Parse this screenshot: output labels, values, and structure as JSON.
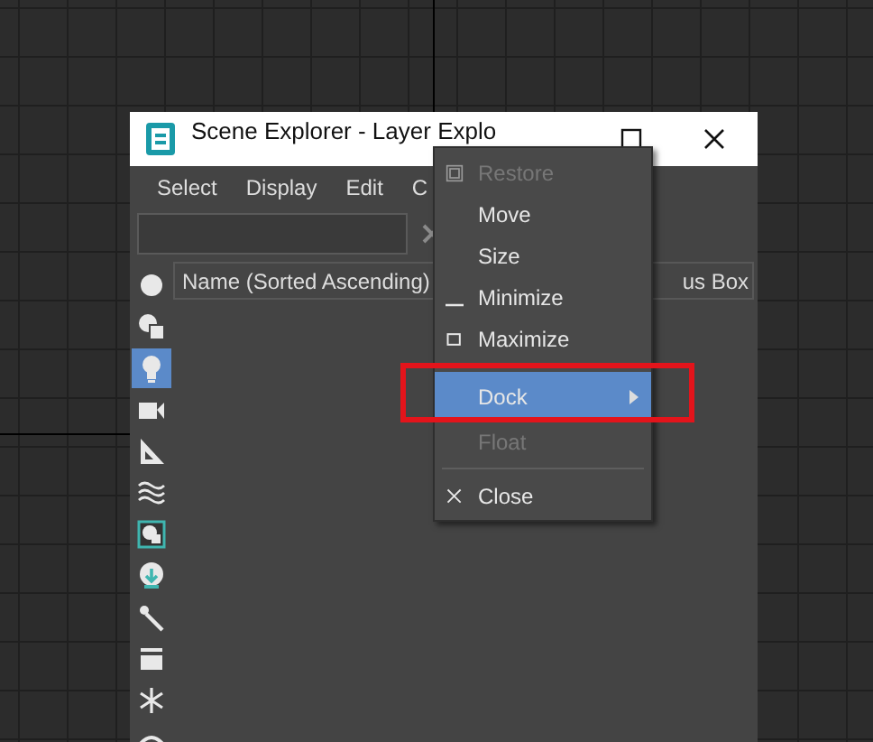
{
  "window": {
    "title": "Scene Explorer - Layer Explo"
  },
  "menu": [
    "Select",
    "Display",
    "Edit",
    "C"
  ],
  "toolbar": [
    {
      "kind": "circle",
      "selected": false
    },
    {
      "kind": "shapes",
      "selected": false
    },
    {
      "kind": "bulb",
      "selected": true
    },
    {
      "kind": "camera",
      "selected": false
    },
    {
      "kind": "ruler",
      "selected": false
    },
    {
      "kind": "waves",
      "selected": false
    },
    {
      "kind": "framed",
      "selected": false
    },
    {
      "kind": "globe",
      "selected": false
    },
    {
      "kind": "pin",
      "selected": false
    },
    {
      "kind": "tray",
      "selected": false
    },
    {
      "kind": "snow",
      "selected": false
    },
    {
      "kind": "eye",
      "selected": false
    }
  ],
  "columns": [
    "Name (Sorted Ascending)",
    "us Box"
  ],
  "context_menu": [
    {
      "kind": "restore",
      "label": "Restore",
      "disabled": true,
      "selected": false
    },
    {
      "kind": "plain",
      "label": "Move",
      "disabled": false,
      "selected": false
    },
    {
      "kind": "plain",
      "label": "Size",
      "disabled": false,
      "selected": false
    },
    {
      "kind": "minimize",
      "label": "Minimize",
      "disabled": false,
      "selected": false
    },
    {
      "kind": "maximize",
      "label": "Maximize",
      "disabled": false,
      "selected": false
    },
    {
      "kind": "separator"
    },
    {
      "kind": "submenu",
      "label": "Dock",
      "disabled": false,
      "selected": true,
      "annotated": true
    },
    {
      "kind": "plain",
      "label": "Float",
      "disabled": true,
      "selected": false
    },
    {
      "kind": "separator"
    },
    {
      "kind": "close",
      "label": "Close",
      "disabled": false,
      "selected": false
    }
  ]
}
